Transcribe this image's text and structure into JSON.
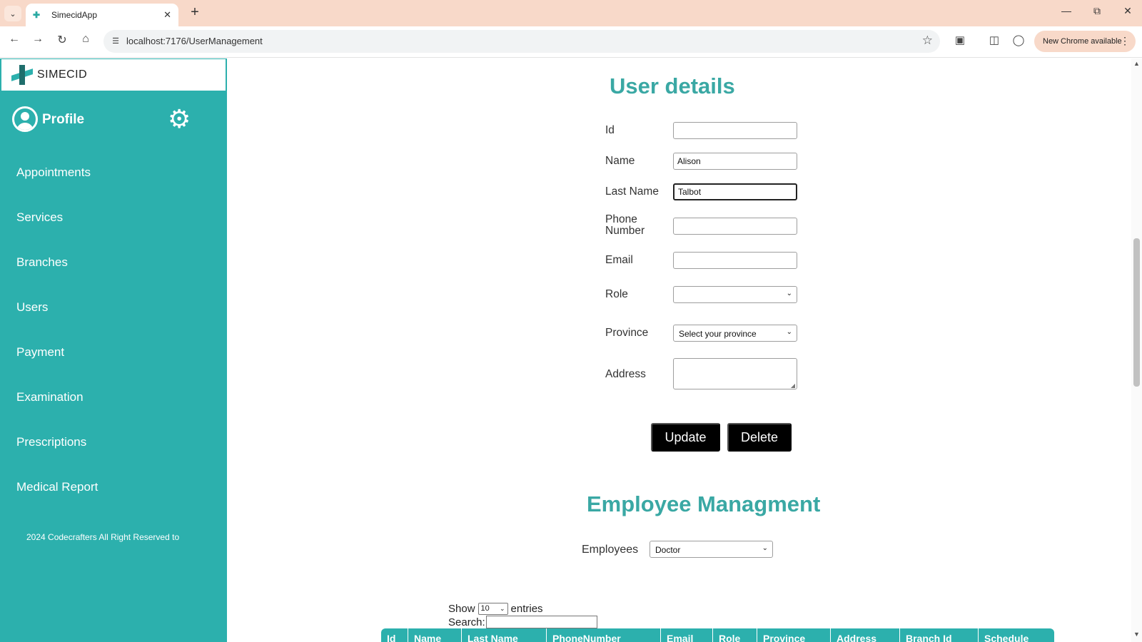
{
  "browser": {
    "tab_title": "SimecidApp",
    "url": "localhost:7176/UserManagement",
    "update_label": "New Chrome available"
  },
  "sidebar": {
    "brand": "SIMECID",
    "profile_label": "Profile",
    "items": [
      {
        "label": "Appointments"
      },
      {
        "label": "Services"
      },
      {
        "label": "Branches"
      },
      {
        "label": "Users"
      },
      {
        "label": "Payment"
      },
      {
        "label": "Examination"
      },
      {
        "label": "Prescriptions"
      },
      {
        "label": "Medical Report"
      }
    ],
    "footer": "2024 Codecrafters All Right Reserved to"
  },
  "form": {
    "title": "User details",
    "id_label": "Id",
    "id_value": "",
    "name_label": "Name",
    "name_value": "Alison",
    "last_name_label": "Last Name",
    "last_name_value": "Talbot",
    "phone_label": "Phone Number",
    "phone_value": "",
    "email_label": "Email",
    "email_value": "",
    "role_label": "Role",
    "role_value": "",
    "province_label": "Province",
    "province_value": "Select your province",
    "address_label": "Address",
    "update_label": "Update",
    "delete_label": "Delete"
  },
  "employees": {
    "title": "Employee Managment",
    "label": "Employees",
    "selected": "Doctor",
    "show_label": "Show",
    "entries_value": "10",
    "entries_label": "entries",
    "search_label": "Search:",
    "columns": [
      "Id",
      "Name",
      "Last Name",
      "PhoneNumber",
      "Email",
      "Role",
      "Province",
      "Address",
      "Branch Id",
      "Schedule"
    ]
  },
  "colors": {
    "accent": "#2cb0ad",
    "heading": "#3aa8a4",
    "chrome_tab": "#f8d9c9"
  }
}
